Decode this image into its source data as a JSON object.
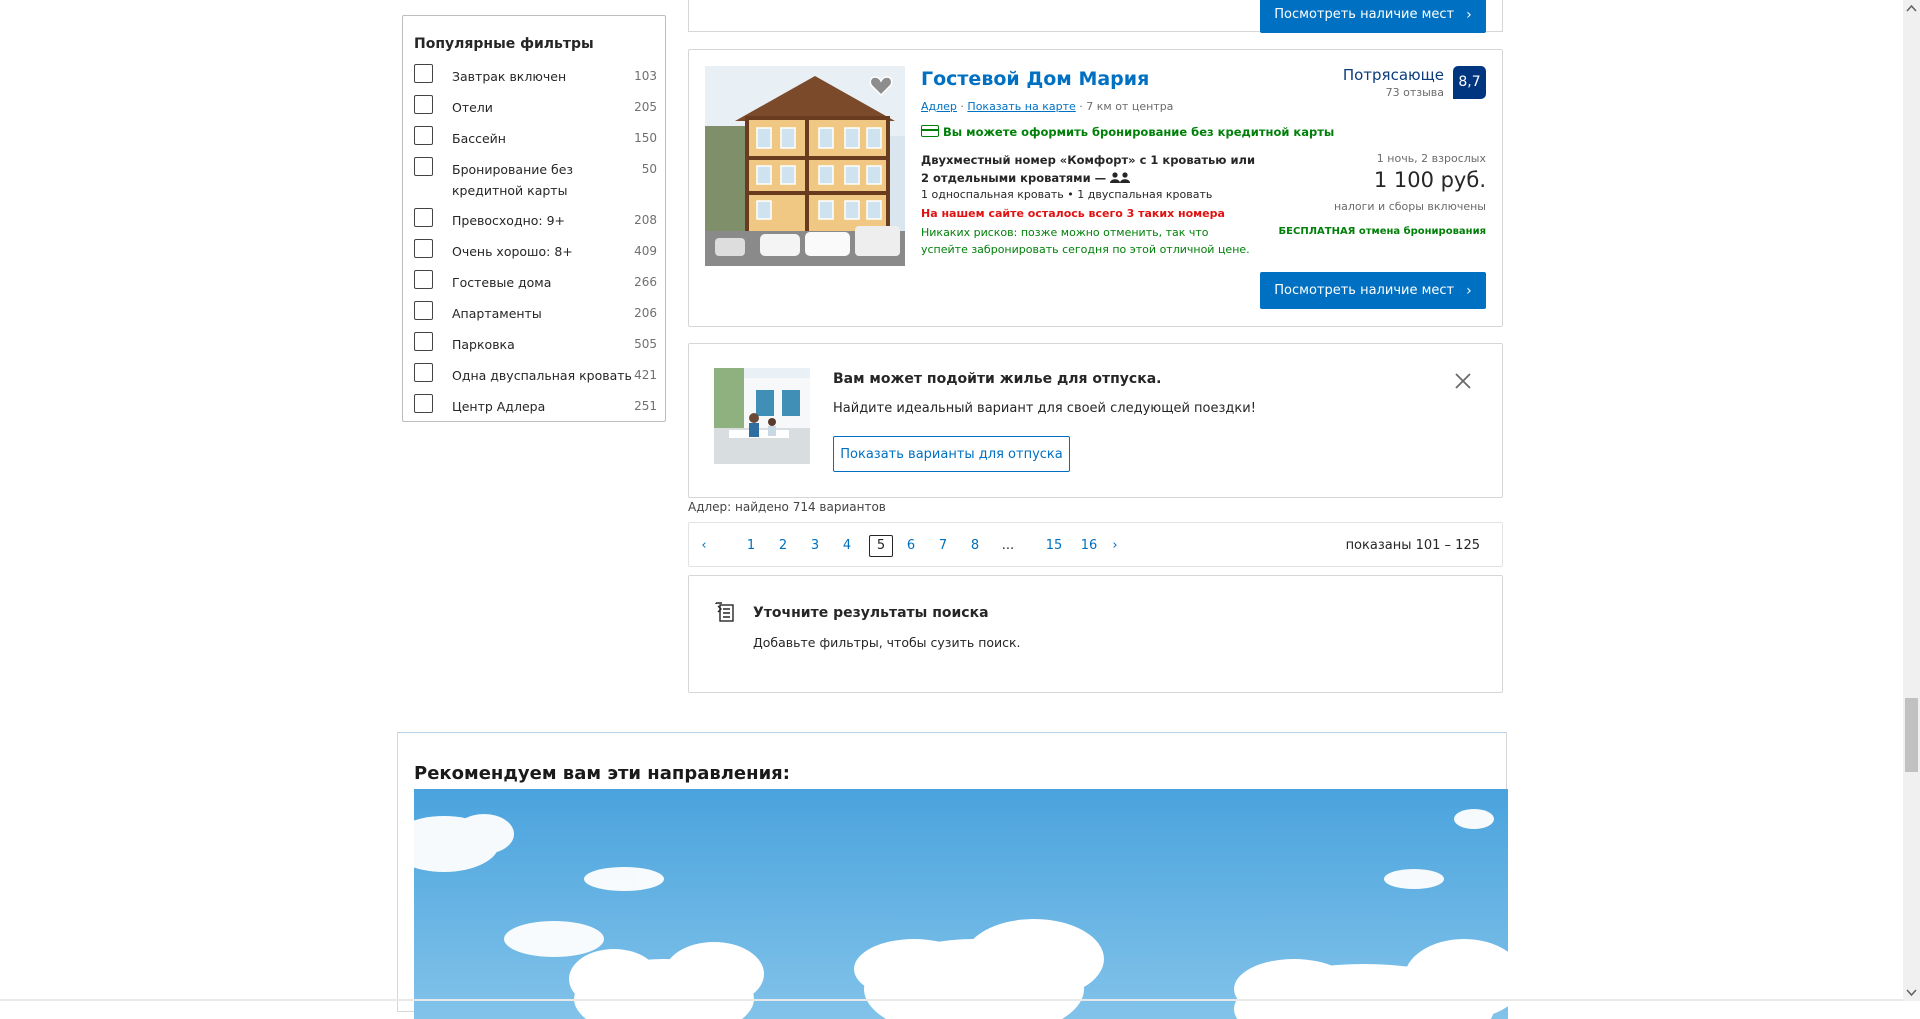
{
  "filters": {
    "heading": "Популярные фильтры",
    "items": [
      {
        "label": "Завтрак включен",
        "count": "103"
      },
      {
        "label": "Отели",
        "count": "205"
      },
      {
        "label": "Бассейн",
        "count": "150"
      },
      {
        "label": "Бронирование без кредитной карты",
        "count": "50"
      },
      {
        "label": "Превосходно: 9+",
        "count": "208"
      },
      {
        "label": "Очень хорошо: 8+",
        "count": "409"
      },
      {
        "label": "Гостевые дома",
        "count": "266"
      },
      {
        "label": "Апартаменты",
        "count": "206"
      },
      {
        "label": "Парковка",
        "count": "505"
      },
      {
        "label": "Одна двуспальная кровать",
        "count": "421"
      },
      {
        "label": "Центр Адлера",
        "count": "251"
      }
    ]
  },
  "prev_card": {
    "button_label": "Посмотреть наличие мест"
  },
  "property": {
    "name": "Гостевой Дом Мария",
    "city_link": "Адлер",
    "map_link": "Показать на карте",
    "distance": "7 км от центра",
    "no_card_text": "Вы можете оформить бронирование без кредитной карты",
    "room_name": "Двухместный номер «Комфорт» с 1 кроватью или 2 отдельными кроватями",
    "room_dash": "—",
    "beds": "1 односпальная кровать • 1 двуспальная кровать",
    "rooms_left": "На нашем сайте осталось всего 3 таких номера",
    "no_risk": "Никаких рисков: позже можно отменить, так что успейте забронировать сегодня по этой отличной цене.",
    "review_word": "Потрясающе",
    "review_count": "73 отзыва",
    "score": "8,7",
    "nights": "1 ночь, 2 взрослых",
    "price": "1 100 руб.",
    "taxes": "налоги и сборы включены",
    "free_cancel": "БЕСПЛАТНАЯ отмена бронирования",
    "button_label": "Посмотреть наличие мест"
  },
  "vacation_banner": {
    "title": "Вам может подойти жилье для отпуска.",
    "subtitle": "Найдите идеальный вариант для своей следующей поездки!",
    "button_label": "Показать варианты для отпуска"
  },
  "results_found": "Адлер: найдено 714 вариантов",
  "pagination": {
    "pages": [
      "1",
      "2",
      "3",
      "4",
      "5",
      "6",
      "7",
      "8",
      "...",
      "15",
      "16"
    ],
    "current": "5",
    "range": "показаны 101 – 125"
  },
  "refine": {
    "title": "Уточните результаты поиска",
    "subtitle": "Добавьте фильтры, чтобы сузить поиск."
  },
  "recommendations": {
    "heading": "Рекомендуем вам эти направления:"
  },
  "colors": {
    "brand_blue": "#0071c2",
    "score_navy": "#003580",
    "green": "#008009",
    "red": "#e21111"
  }
}
